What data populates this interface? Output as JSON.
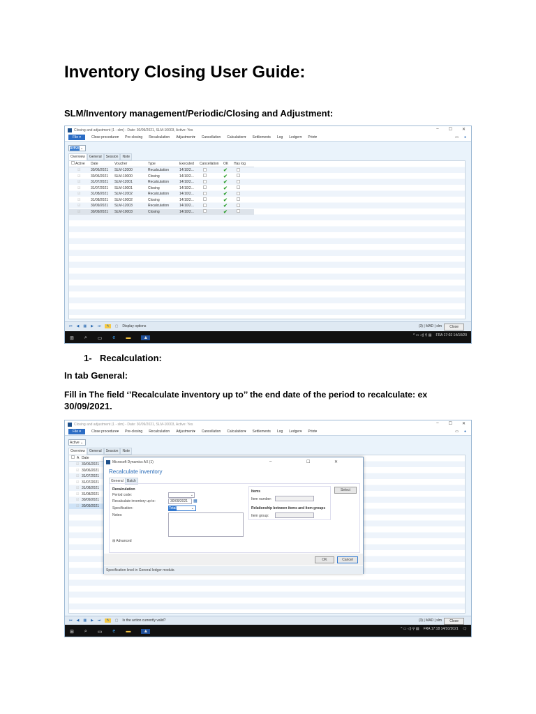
{
  "doc": {
    "title": "Inventory Closing User Guide:",
    "path": "SLM/Inventory management/Periodic/Closing and Adjustment:",
    "step_number": "1-",
    "step_title": "Recalculation:",
    "tab_note": "In tab General:",
    "instruction_line1": "Fill in The field ‘’Recalculate inventory up to’’ the end date of the period to recalculate: ex",
    "instruction_line2": "30/09/2021."
  },
  "window": {
    "title": "Closing and adjustment (1 - slm) - Date: 30/09/2021, SLM-10003, Active: Yes",
    "file": "File ▾",
    "menu": [
      "Close procedure▾",
      "Pre-closing",
      "Recalculation",
      "Adjustment▾",
      "Cancellation",
      "Calculation▾",
      "Settlements",
      "Log",
      "Ledger▾",
      "Print▾"
    ],
    "active_filter": "Active",
    "tabs": [
      "Overview",
      "General",
      "Session",
      "Note"
    ],
    "columns": [
      "Active",
      "Date",
      "Voucher",
      "Type",
      "Executed",
      "Cancellation",
      "OK",
      "Has log"
    ],
    "rows": [
      {
        "date": "30/06/2021",
        "voucher": "SLM-12000",
        "type": "Recalculation",
        "executed": "14/10/2..."
      },
      {
        "date": "30/06/2021",
        "voucher": "SLM-10000",
        "type": "Closing",
        "executed": "14/10/2..."
      },
      {
        "date": "31/07/2021",
        "voucher": "SLM-12001",
        "type": "Recalculation",
        "executed": "14/10/2..."
      },
      {
        "date": "31/07/2021",
        "voucher": "SLM-10001",
        "type": "Closing",
        "executed": "14/10/2..."
      },
      {
        "date": "31/08/2021",
        "voucher": "SLM-12002",
        "type": "Recalculation",
        "executed": "14/10/2..."
      },
      {
        "date": "31/08/2021",
        "voucher": "SLM-10002",
        "type": "Closing",
        "executed": "14/10/2..."
      },
      {
        "date": "30/09/2021",
        "voucher": "SLM-12003",
        "type": "Recalculation",
        "executed": "14/10/2..."
      },
      {
        "date": "30/09/2021",
        "voucher": "SLM-10003",
        "type": "Closing",
        "executed": "14/10/2..."
      }
    ],
    "status1": "Display options",
    "status2": "Is the action currently valid?",
    "status_right": "(3) | MAD | slm",
    "close": "Close",
    "tray1": "FRA 17:02 14/10/20",
    "tray2": "FRA 17:18 14/10/2021",
    "collapsed_col": "A"
  },
  "dialog": {
    "app": "Microsoft Dynamics AX (1)",
    "title": "Recalculate inventory",
    "tabs": [
      "General",
      "Batch"
    ],
    "section": "Recalculation",
    "period_code": "Period code:",
    "up_to_label": "Recalculate inventory up to:",
    "up_to_value": "30/09/2021",
    "spec_label": "Specification:",
    "spec_value": "Total",
    "note_label": "Notes:",
    "advanced": "⊞ Advanced",
    "items_title": "Items",
    "item_number": "Item number:",
    "rel_title": "Relationship between items and item groups",
    "item_group": "Item group:",
    "select": "Select",
    "ok": "OK",
    "cancel": "Cancel",
    "status": "Specification level in General ledger module."
  }
}
